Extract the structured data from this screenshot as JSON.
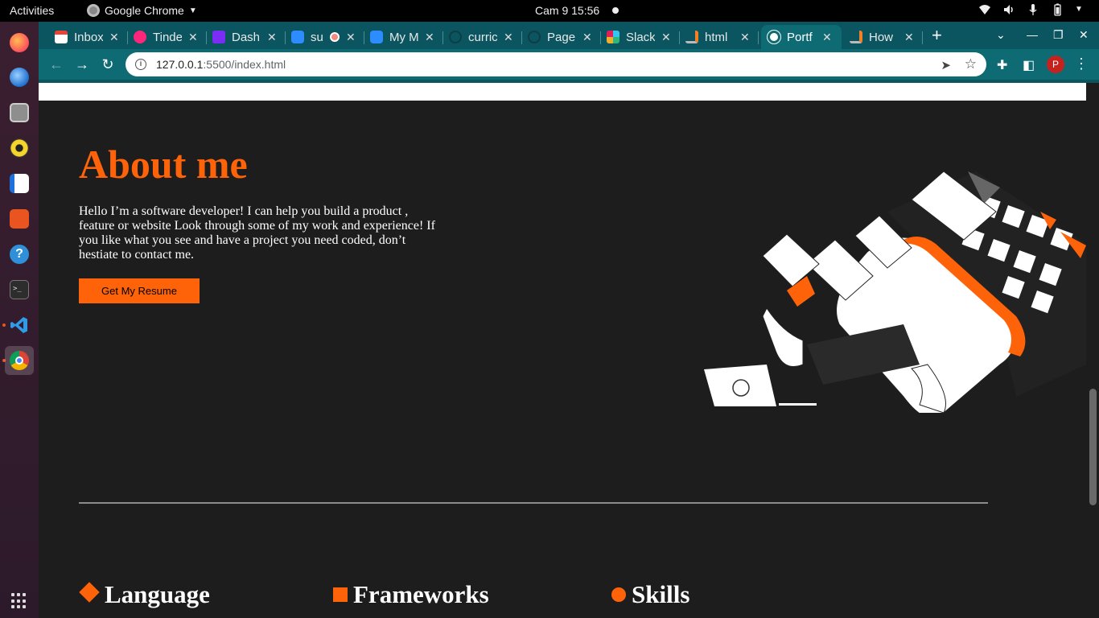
{
  "system_bar": {
    "activities": "Activities",
    "app_name": "Google Chrome",
    "clock": "Cam 9  15:56"
  },
  "dock": {
    "items": [
      "firefox-icon",
      "thunderbird-icon",
      "files-icon",
      "rhythmbox-icon",
      "writer-icon",
      "software-icon",
      "help-icon",
      "terminal-icon",
      "vscode-icon",
      "chrome-icon"
    ],
    "active": "chrome-icon"
  },
  "tabs": [
    {
      "title": "Inbox",
      "favicon": "gmail-icon",
      "color": "#ea4335"
    },
    {
      "title": "Tinder",
      "favicon": "tinder-icon",
      "color": "#fd267a"
    },
    {
      "title": "Dash",
      "favicon": "dash-icon",
      "color": "#7b2cf5"
    },
    {
      "title": "su",
      "favicon": "zoom-icon",
      "color": "#2d8cff"
    },
    {
      "title": "My M",
      "favicon": "zoom-icon",
      "color": "#2d8cff"
    },
    {
      "title": "curric",
      "favicon": "github-icon",
      "color": "#0b5560"
    },
    {
      "title": "Page",
      "favicon": "github-icon",
      "color": "#0b5560"
    },
    {
      "title": "Slack",
      "favicon": "slack-icon",
      "color": "#e01e5a"
    },
    {
      "title": "html",
      "favicon": "stackoverflow-icon",
      "color": "#f48024"
    },
    {
      "title": "Portf",
      "favicon": "globe-icon",
      "color": "#ffffff",
      "active": true
    },
    {
      "title": "How",
      "favicon": "stackoverflow-icon",
      "color": "#f48024"
    }
  ],
  "address_bar": {
    "host": "127.0.0.1",
    "path": ":5500/index.html"
  },
  "profile_initial": "P",
  "page": {
    "about_title": "About me",
    "about_text": "Hello I’m a software developer! I can help you build a product , feature or website Look through some of my work and experience! If you like what you see and have a project you need coded, don’t hestiate to contact me.",
    "resume_button": "Get My Resume",
    "categories": [
      "Language",
      "Frameworks",
      "Skills"
    ]
  },
  "colors": {
    "accent": "#ff6309",
    "page_bg": "#1d1d1d",
    "chrome_teal": "#0e6b74"
  }
}
